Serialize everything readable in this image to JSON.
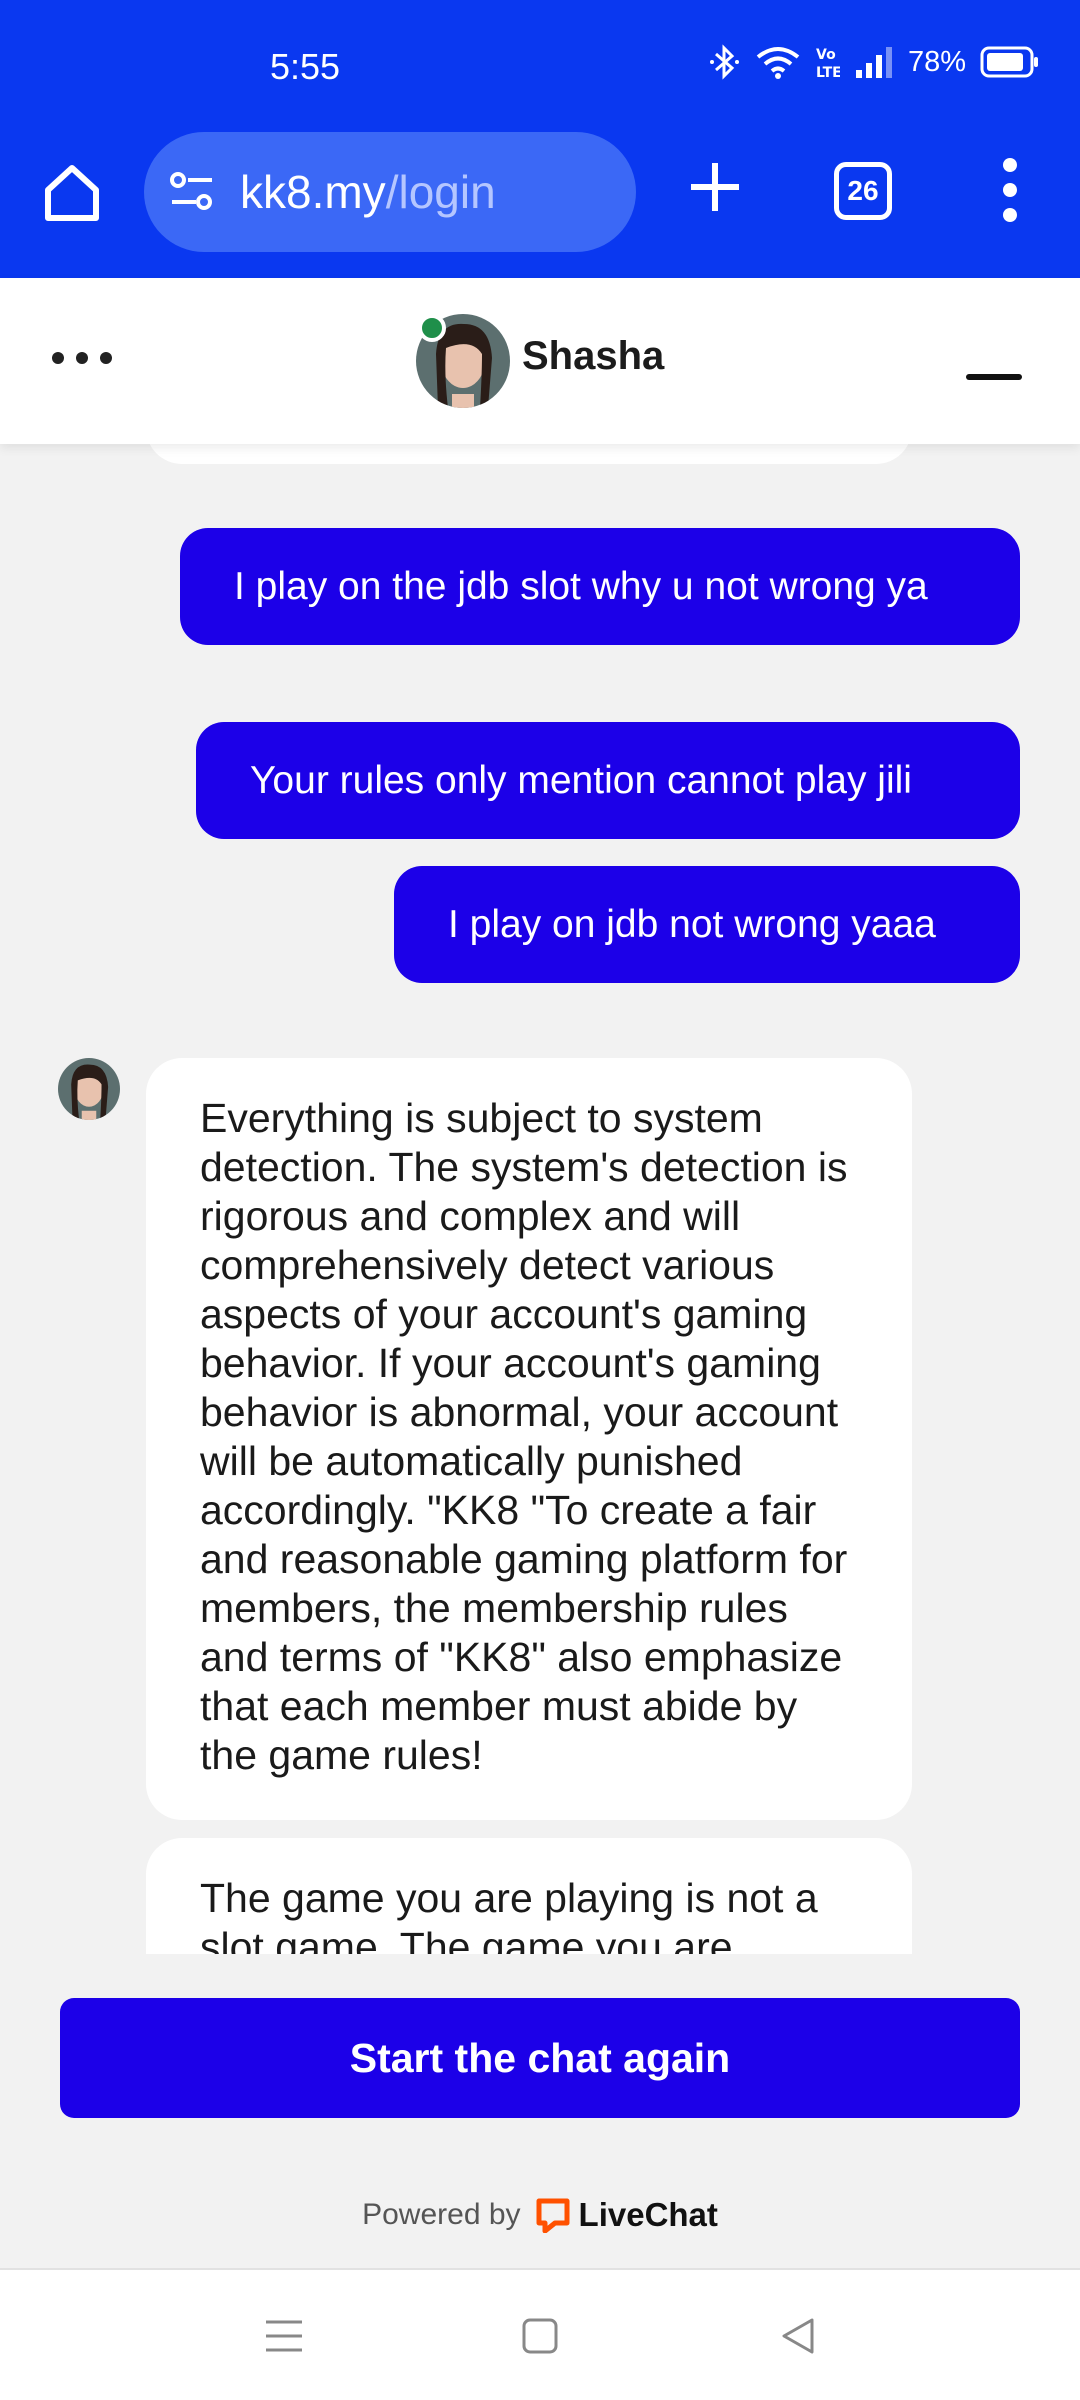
{
  "status_bar": {
    "time": "5:55",
    "battery": "78%",
    "icons": [
      "bluetooth-icon",
      "wifi-icon",
      "volte-icon",
      "signal-icon",
      "battery-icon"
    ]
  },
  "browser": {
    "url_domain": "kk8.my",
    "url_path": "/login",
    "tab_count": "26",
    "accent_color": "#0a38f0"
  },
  "chat_header": {
    "agent_name": "Shasha",
    "online_color": "#1f8f4a"
  },
  "messages": {
    "outgoing": [
      "I play on the jdb slot why u not wrong ya",
      "Your rules only mention cannot play jili",
      "I play on jdb not wrong yaaa"
    ],
    "incoming": [
      "Everything is subject to system detection. The system's detection is rigorous and complex and will comprehensively detect various aspects of your account's gaming behavior. If your account's gaming behavior is abnormal, your account will be automatically punished accordingly. \"KK8 \"To create a fair and reasonable gaming platform for members, the membership rules and terms of \"KK8\" also emphasize that each member must abide by the game rules!",
      "The game you are playing is not a slot game. The game you are"
    ],
    "bubble_color": "#1c00e8"
  },
  "footer": {
    "restart_label": "Start the chat again",
    "powered_by": "Powered by",
    "brand": "LiveChat",
    "brand_color": "#ff5100"
  },
  "nav_bar": {
    "items": [
      "menu-icon",
      "home-square-icon",
      "back-triangle-icon"
    ]
  }
}
